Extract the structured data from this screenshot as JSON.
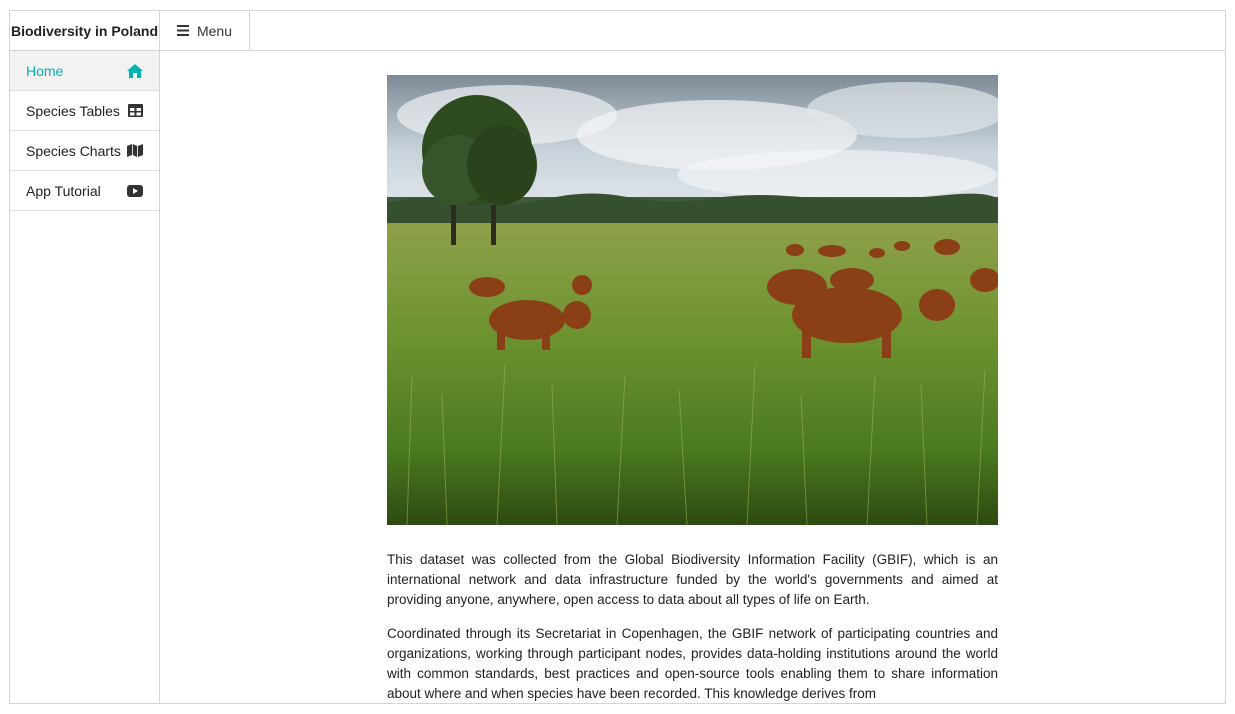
{
  "app": {
    "title": "Biodiversity in Poland",
    "menu_label": "Menu",
    "accent": "#00b5ad"
  },
  "sidebar": {
    "items": [
      {
        "label": "Home",
        "icon": "home-icon",
        "active": true
      },
      {
        "label": "Species Tables",
        "icon": "table-icon",
        "active": false
      },
      {
        "label": "Species Charts",
        "icon": "map-icon",
        "active": false
      },
      {
        "label": "App Tutorial",
        "icon": "youtube-icon",
        "active": false
      }
    ]
  },
  "main": {
    "image": "landscape-photo-highland-cattle-meadow",
    "paragraphs": [
      "This dataset was collected from the Global Biodiversity Information Facility (GBIF), which is an international network and data infrastructure funded by the world's governments and aimed at providing anyone, anywhere, open access to data about all types of life on Earth.",
      "Coordinated through its Secretariat in Copenhagen, the GBIF network of participating countries and organizations, working through participant nodes, provides data-holding institutions around the world with common standards, best practices and open-source tools enabling them to share information about where and when species have been recorded. This knowledge derives from"
    ]
  }
}
